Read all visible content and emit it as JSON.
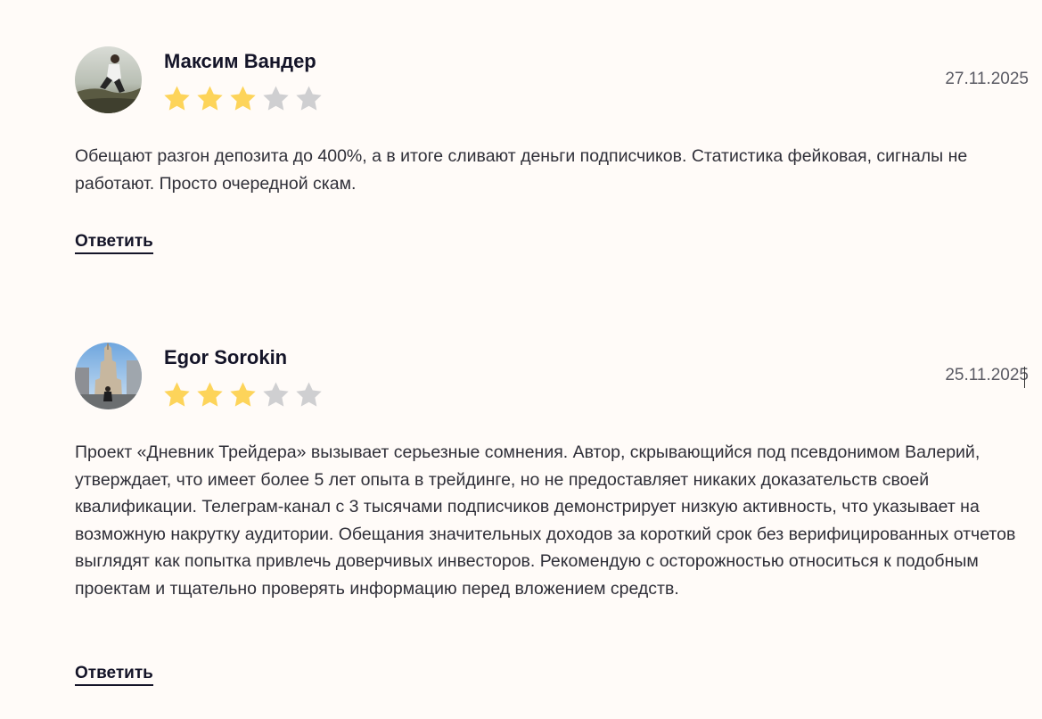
{
  "colors": {
    "background": "#fffbf8",
    "star_filled": "#fdd45a",
    "star_empty": "#cfcfd1",
    "author": "#141428"
  },
  "reviews": [
    {
      "author": "Максим Вандер",
      "date": "27.11.2025",
      "rating": 3,
      "rating_max": 5,
      "avatar_icon": "user-photo-avatar",
      "text": "Обещают разгон депозита до 400%, а в итоге сливают деньги подписчиков. Статистика фейковая, сигналы не работают. Просто очередной скам.",
      "reply_label": "Ответить"
    },
    {
      "author": "Egor Sorokin",
      "date": "25.11.2025",
      "rating": 3,
      "rating_max": 5,
      "avatar_icon": "user-photo-avatar",
      "text": "Проект «Дневник Трейдера» вызывает серьезные сомнения. Автор, скрывающийся под псевдонимом Валерий, утверждает, что имеет более 5 лет опыта в трейдинге, но не предоставляет никаких доказательств своей квалификации. Телеграм-канал с 3 тысячами подписчиков демонстрирует низкую активность, что указывает на возможную накрутку аудитории. Обещания значительных доходов за короткий срок без верифицированных отчетов выглядят как попытка привлечь доверчивых инвесторов. Рекомендую с осторожностью относиться к подобным проектам и тщательно проверять информацию перед вложением средств.",
      "reply_label": "Ответить"
    }
  ]
}
